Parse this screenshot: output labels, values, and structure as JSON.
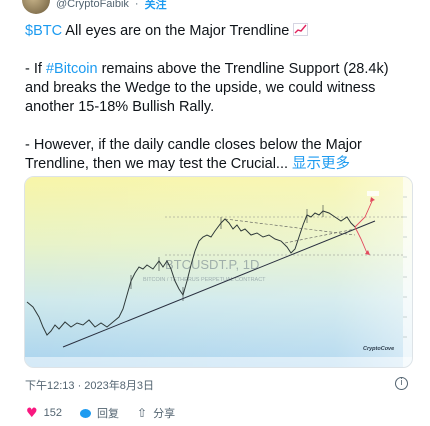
{
  "header": {
    "handle": "@CryptoFaibik",
    "separator": "·",
    "follow_label": "关注"
  },
  "tweet": {
    "cashtag": "$BTC",
    "line1_rest": " All eyes are on the Major Trendline ",
    "p2_prefix": "- If ",
    "hashtag": "#Bitcoin",
    "p2_rest": " remains above the Trendline Support (28.4k) and breaks the Wedge to the upside, we could witness another 15-18% Bullish Rally.",
    "p3_text": "- However, if the daily candle closes below the Major Trendline, then we may test the Crucial... ",
    "show_more": "显示更多"
  },
  "chart_image": {
    "watermark_title": "BTCUSDT.P, 1D",
    "watermark_sub": "BITCOIN / TETHERUS PERPETUAL CONTRACT",
    "brand": "CryptoCove"
  },
  "meta": {
    "timestamp": "下午12:13 · 2023年8月3日"
  },
  "actions": {
    "likes": "152",
    "reply_label": "回复",
    "share_label": "分享"
  },
  "colors": {
    "accent": "#1d9bf0",
    "like": "#f91880"
  }
}
